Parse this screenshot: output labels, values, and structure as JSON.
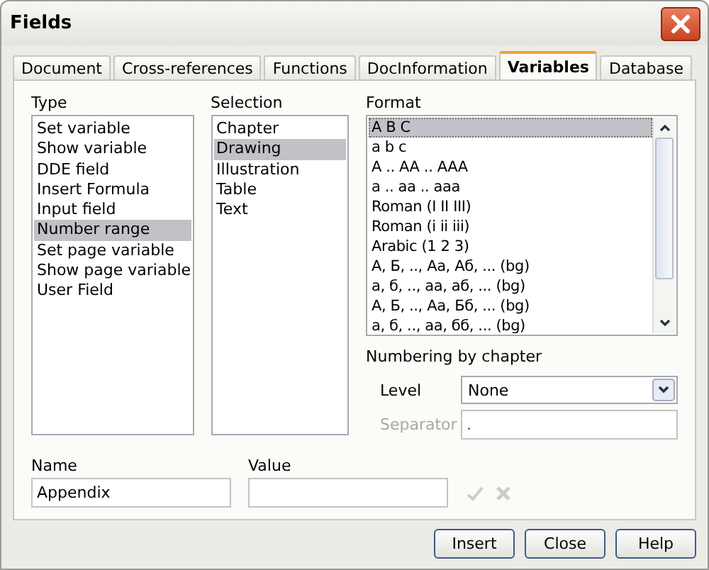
{
  "window": {
    "title": "Fields"
  },
  "tabs": [
    {
      "label": "Document",
      "selected": false
    },
    {
      "label": "Cross-references",
      "selected": false
    },
    {
      "label": "Functions",
      "selected": false
    },
    {
      "label": "DocInformation",
      "selected": false
    },
    {
      "label": "Variables",
      "selected": true
    },
    {
      "label": "Database",
      "selected": false
    }
  ],
  "type": {
    "label": "Type",
    "items": [
      {
        "label": "Set variable",
        "selected": false
      },
      {
        "label": "Show variable",
        "selected": false
      },
      {
        "label": "DDE field",
        "selected": false
      },
      {
        "label": "Insert Formula",
        "selected": false
      },
      {
        "label": "Input field",
        "selected": false
      },
      {
        "label": "Number range",
        "selected": true
      },
      {
        "label": "Set page variable",
        "selected": false
      },
      {
        "label": "Show page variable",
        "selected": false
      },
      {
        "label": "User Field",
        "selected": false
      }
    ]
  },
  "selection": {
    "label": "Selection",
    "items": [
      {
        "label": "Chapter",
        "selected": false
      },
      {
        "label": "Drawing",
        "selected": true
      },
      {
        "label": "Illustration",
        "selected": false
      },
      {
        "label": "Table",
        "selected": false
      },
      {
        "label": "Text",
        "selected": false
      }
    ]
  },
  "format": {
    "label": "Format",
    "items": [
      {
        "label": "A B C",
        "selected": true
      },
      {
        "label": "a b c",
        "selected": false
      },
      {
        "label": "A .. AA .. AAA",
        "selected": false
      },
      {
        "label": "a .. aa .. aaa",
        "selected": false
      },
      {
        "label": "Roman (I II III)",
        "selected": false
      },
      {
        "label": "Roman (i ii iii)",
        "selected": false
      },
      {
        "label": "Arabic (1 2 3)",
        "selected": false
      },
      {
        "label": "А, Б, .., Аа, Аб, ... (bg)",
        "selected": false
      },
      {
        "label": "а, б, .., аа, аб, ... (bg)",
        "selected": false
      },
      {
        "label": "А, Б, .., Аа, Бб, ... (bg)",
        "selected": false
      },
      {
        "label": "а, б, .., аа, бб, ... (bg)",
        "selected": false
      }
    ]
  },
  "numbering_by_chapter": {
    "label": "Numbering by chapter",
    "level": {
      "label": "Level",
      "value": "None"
    },
    "separator": {
      "label": "Separator",
      "value": ".",
      "disabled": true
    }
  },
  "name": {
    "label": "Name",
    "value": "Appendix"
  },
  "value": {
    "label": "Value"
  },
  "apply_disabled": true,
  "buttons": [
    "Insert",
    "Close",
    "Help"
  ]
}
